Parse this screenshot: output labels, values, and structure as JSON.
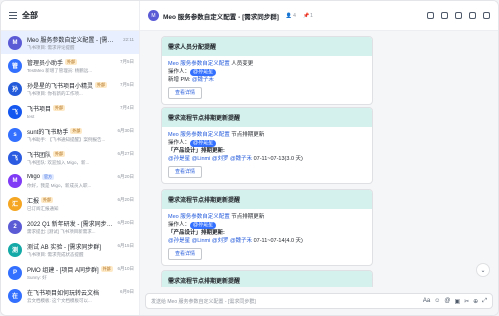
{
  "sidebar": {
    "header_title": "全部",
    "items": [
      {
        "name": "Meo 服务参数自定义配置 - [需求同步群]",
        "tag": "",
        "tag_type": "",
        "time": "22:11",
        "preview": "飞书项目: 需求评论提醒",
        "avatar_color": "#5b5bd6",
        "avatar_text": "M"
      },
      {
        "name": "管理员小助手",
        "tag": "外部",
        "tag_type": "ext",
        "time": "7月5日",
        "preview": "TestMeo 新增了管理员: 杨鹏远...",
        "avatar_color": "#3370ff",
        "avatar_text": "管"
      },
      {
        "name": "孙是星的飞书项目小精灵",
        "tag": "外部",
        "tag_type": "ext",
        "time": "7月5日",
        "preview": "飞书项目: 你有新的工作项...",
        "avatar_color": "#245bdb",
        "avatar_text": "孙"
      },
      {
        "name": "飞书项目",
        "tag": "外部",
        "tag_type": "ext",
        "time": "7月4日",
        "preview": "test",
        "avatar_color": "#1456f0",
        "avatar_text": "飞"
      },
      {
        "name": "sunt的飞书助手",
        "tag": "外部",
        "tag_type": "ext",
        "time": "6月30日",
        "preview": "飞书助手: 【飞书通知提醒】案例报告...",
        "avatar_color": "#3370ff",
        "avatar_text": "s"
      },
      {
        "name": "飞书团队",
        "tag": "外部",
        "tag_type": "ext",
        "time": "6月27日",
        "preview": "飞书团队: 欢迎加入 Migo，新...",
        "avatar_color": "#2b5be0",
        "avatar_text": "飞"
      },
      {
        "name": "Migo",
        "tag": "官方",
        "tag_type": "off",
        "time": "6月20日",
        "preview": "你好，我是 Migo，新成员入职...",
        "avatar_color": "#7f3bf5",
        "avatar_text": "M"
      },
      {
        "name": "汇报",
        "tag": "外部",
        "tag_type": "ext",
        "time": "6月20日",
        "preview": "已订阅汇报通知",
        "avatar_color": "#f5a623",
        "avatar_text": "汇"
      },
      {
        "name": "2022 Q1 新年研发 - [需求同步群]",
        "tag": "",
        "tag_type": "",
        "time": "6月20日",
        "preview": "需求提出: [测试] 飞书项目新需求...",
        "avatar_color": "#5b5bd6",
        "avatar_text": "2"
      },
      {
        "name": "测试 AB 实验 - [需求同步群]",
        "tag": "",
        "tag_type": "",
        "time": "6月15日",
        "preview": "飞书项目: 需求完成状态提醒",
        "avatar_color": "#14a9a6",
        "avatar_text": "测"
      },
      {
        "name": "PMO 组建 - [项目 A同步群]",
        "tag": "外部",
        "tag_type": "ext",
        "time": "6月10日",
        "preview": "Sunny: 好",
        "avatar_color": "#3370ff",
        "avatar_text": "P"
      },
      {
        "name": "在飞书项目如何玩转云文档",
        "tag": "",
        "tag_type": "",
        "time": "6月9日",
        "preview": "云文档模板: 这个文档模板可以...",
        "avatar_color": "#3370ff",
        "avatar_text": "在"
      }
    ]
  },
  "chat": {
    "title": "Meo 服务参数自定义配置 - [需求同步群]",
    "member_count": "4",
    "pin_count": "1",
    "cards": [
      {
        "title": "需求人员分配提醒",
        "line1_link": "Meo 服务参数自定义配置",
        "line1_rest": " 人员变更",
        "operator_label": "操作人：",
        "operator": "@孙是星",
        "line3_label": "新增 PM: ",
        "line3_value": "@魏子禾",
        "button": "查看详情"
      },
      {
        "title": "需求流程节点排期更新提醒",
        "line1_link": "Meo 服务参数自定义配置",
        "line1_rest": " 节点排期更新",
        "operator_label": "操作人：",
        "operator": "@孙是星",
        "section": "「产品设计」排期更新:",
        "assignees": "@孙是星 @Linmi @刘罗 @魏子禾",
        "dates": " 07-11~07-13(3.0 天)",
        "button": "查看详情"
      },
      {
        "title": "需求流程节点排期更新提醒",
        "line1_link": "Meo 服务参数自定义配置",
        "line1_rest": " 节点排期更新",
        "operator_label": "操作人：",
        "operator": "@孙是星",
        "section": "「产品设计」排期更新:",
        "assignees": "@孙是星 @Linmi @刘罗 @魏子禾",
        "dates": " 07-11~07-14(4.0 天)",
        "button": "查看详情"
      },
      {
        "title": "需求流程节点排期更新提醒"
      }
    ],
    "composer_placeholder": "发送给 Meo 服务参数自定义配置 - [需求同步群]"
  }
}
